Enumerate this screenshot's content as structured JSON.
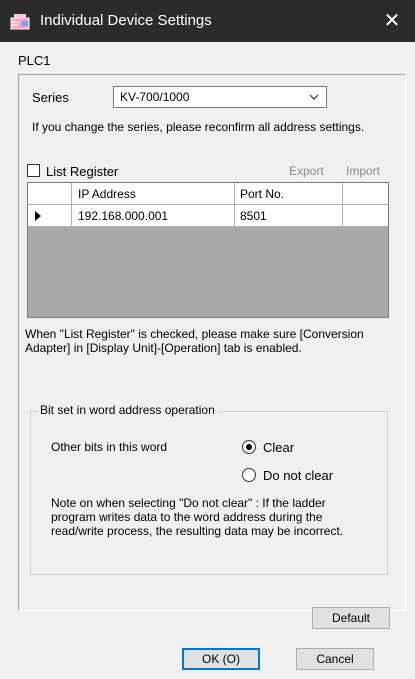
{
  "window": {
    "title": "Individual Device Settings",
    "icon": "device-settings-icon",
    "close_glyph": "✕"
  },
  "device_name": "PLC1",
  "series": {
    "label": "Series",
    "value": "KV-700/1000",
    "note": "If you change the series, please reconfirm all address settings."
  },
  "list_register": {
    "label": "List Register",
    "checked": false,
    "export_label": "Export",
    "import_label": "Import"
  },
  "table": {
    "columns": [
      "IP Address",
      "Port No."
    ],
    "rows": [
      {
        "ip": "192.168.000.001",
        "port": "8501"
      }
    ]
  },
  "list_register_note": "When \"List Register\" is checked, please make sure [Conversion Adapter] in [Display Unit]-[Operation] tab is enabled.",
  "bit_set": {
    "group_title": "Bit set in word address operation",
    "other_bits_label": "Other bits in this word",
    "options": [
      "Clear",
      "Do not clear"
    ],
    "selected": "Clear",
    "note": "Note on when selecting \"Do not clear\" : If the ladder program writes data to the word address during the read/write process, the resulting data may be incorrect."
  },
  "buttons": {
    "default": "Default",
    "ok": "OK (O)",
    "cancel": "Cancel"
  },
  "colors": {
    "titlebar_bg": "#2b2b2b",
    "focus_accent": "#0078d7",
    "grid_background": "#a9a9a9",
    "disabled_text": "#8a8a8a"
  }
}
